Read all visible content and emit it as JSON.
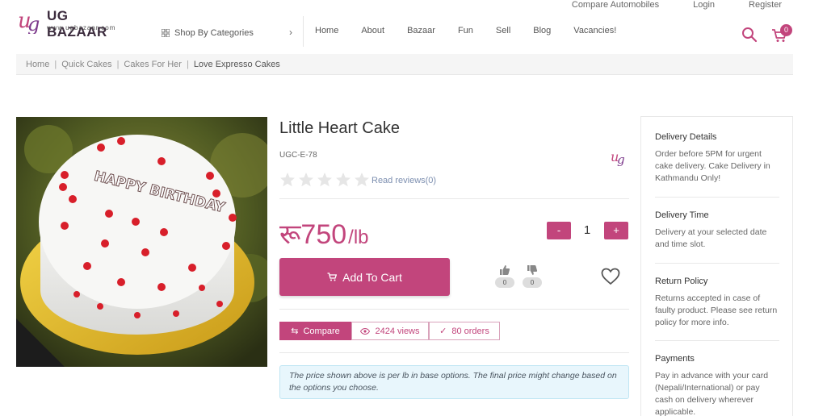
{
  "brand": {
    "name": "UG BAZAAR",
    "url_text": "www.ugbazaar.com",
    "accent": "#c2457c"
  },
  "top_links": [
    "Compare Automobiles",
    "Login",
    "Register"
  ],
  "shop_categories_label": "Shop By Categories",
  "nav": [
    "Home",
    "About",
    "Bazaar",
    "Fun",
    "Sell",
    "Blog",
    "Vacancies!"
  ],
  "cart_count": "0",
  "breadcrumb": [
    "Home",
    "Quick Cakes",
    "Cakes For Her",
    "Love Expresso Cakes"
  ],
  "product": {
    "title": "Little Heart Cake",
    "sku": "UGC-E-78",
    "reviews_link": "Read reviews(0)",
    "rating": 0,
    "price_symbol": "रू",
    "price": "750",
    "price_unit": "/lb",
    "quantity": "1",
    "qty_minus": "-",
    "qty_plus": "+",
    "add_to_cart": "Add To Cart",
    "likes": "0",
    "dislikes": "0",
    "compare": "Compare",
    "views": "2424 views",
    "orders": "80 orders",
    "notice": "The price shown above is per lb in base options. The final price might change based on the options you choose.",
    "cake_text": "HAPPY BIRTHDAY"
  },
  "side": [
    {
      "heading": "Delivery Details",
      "text": "Order before 5PM for urgent cake delivery. Cake Delivery in Kathmandu Only!"
    },
    {
      "heading": "Delivery Time",
      "text": "Delivery at your selected date and time slot."
    },
    {
      "heading": "Return Policy",
      "text": "Returns accepted in case of faulty product. Please see return policy for more info."
    },
    {
      "heading": "Payments",
      "text": "Pay in advance with your card (Nepali/International) or pay cash on delivery wherever applicable."
    }
  ]
}
